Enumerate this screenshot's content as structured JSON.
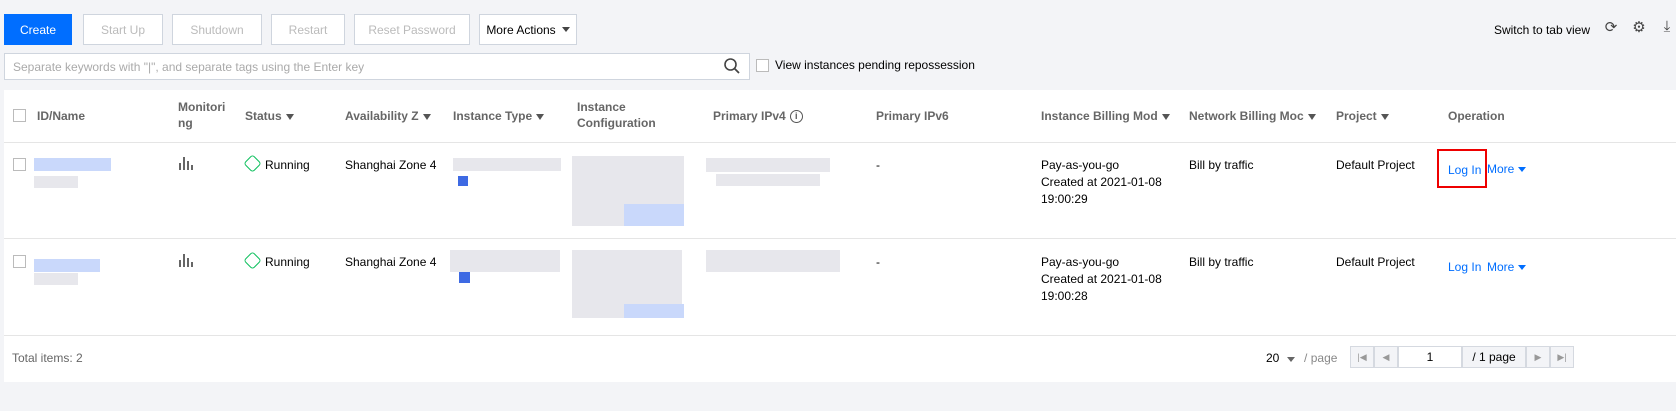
{
  "toolbar": {
    "create": "Create",
    "start_up": "Start Up",
    "shutdown": "Shutdown",
    "restart": "Restart",
    "reset_password": "Reset Password",
    "more_actions": "More Actions",
    "switch_view": "Switch to tab view",
    "icons": [
      "refresh-icon",
      "gear-icon",
      "download-icon"
    ]
  },
  "search": {
    "placeholder": "Separate keywords with \"|\", and separate tags using the Enter key",
    "pending_label": "View instances pending repossession"
  },
  "table": {
    "headers": {
      "id_name": "ID/Name",
      "monitoring": "Monitori ng",
      "status": "Status",
      "zone": "Availability Z",
      "type": "Instance Type",
      "config": "Instance Configuration",
      "ipv4": "Primary IPv4",
      "ipv6": "Primary IPv6",
      "billing": "Instance Billing Mod",
      "network_billing": "Network Billing Moc",
      "project": "Project",
      "operation": "Operation"
    },
    "rows": [
      {
        "status": "Running",
        "zone": "Shanghai Zone 4",
        "ipv6": "-",
        "billing_mode": "Pay-as-you-go",
        "created": "Created at 2021-01-08",
        "created_time": "19:00:29",
        "network_billing": "Bill by traffic",
        "project": "Default Project",
        "login": "Log In",
        "more": "More"
      },
      {
        "status": "Running",
        "zone": "Shanghai Zone 4",
        "ipv6": "-",
        "billing_mode": "Pay-as-you-go",
        "created": "Created at 2021-01-08",
        "created_time": "19:00:28",
        "network_billing": "Bill by traffic",
        "project": "Default Project",
        "login": "Log In",
        "more": "More"
      }
    ]
  },
  "footer": {
    "total": "Total items: 2",
    "per_page": "20",
    "per_page_label": "/ page",
    "page_input": "1",
    "page_total": "/ 1 page"
  },
  "colors": {
    "primary": "#006eff",
    "running": "#0abf5b",
    "highlight": "#e00000"
  }
}
